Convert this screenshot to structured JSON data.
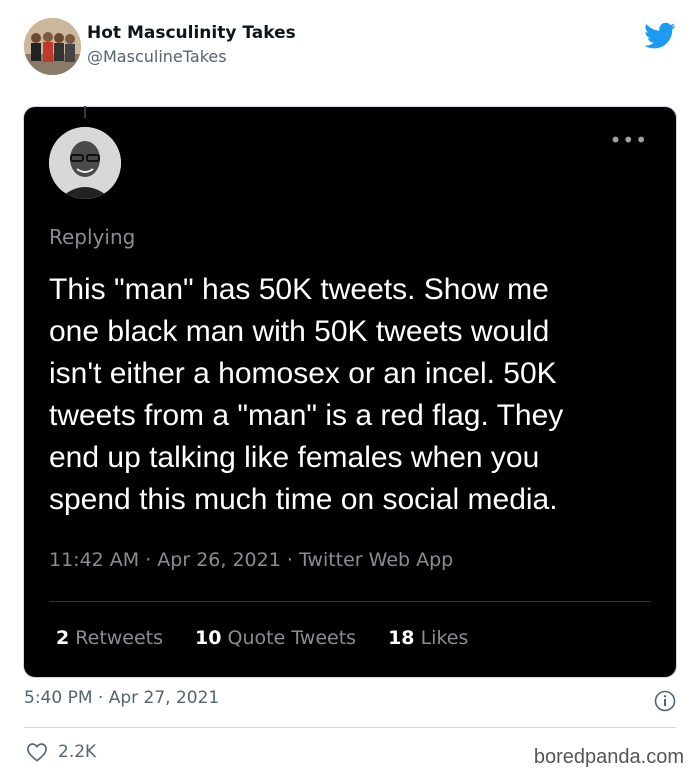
{
  "author": {
    "name": "Hot Masculinity Takes",
    "handle": "@MasculineTakes",
    "avatar_icon": "group-photo-avatar"
  },
  "brand": {
    "icon": "twitter-bird-icon",
    "color": "#1d9bf0"
  },
  "quoted_tweet": {
    "avatar_icon": "bw-portrait-avatar",
    "more_icon": "more-dots-icon",
    "more_label": "•••",
    "replying": "Replying",
    "text_lines": [
      "This \"man\" has 50K tweets.  Show me",
      "one black man with 50K tweets would",
      "isn't either a homosex or an incel.  50K",
      "tweets from a \"man\" is a red flag.  They",
      "end up talking like females when you",
      "spend this much time on social media."
    ],
    "meta": "11:42 AM · Apr 26, 2021 · Twitter Web App",
    "stats": {
      "retweets_count": "2",
      "retweets_label": "Retweets",
      "quotes_count": "10",
      "quotes_label": "Quote Tweets",
      "likes_count": "18",
      "likes_label": "Likes"
    }
  },
  "footer": {
    "timestamp": "5:40 PM · Apr 27, 2021",
    "likes": "2.2K",
    "watermark": "boredpanda.com"
  }
}
